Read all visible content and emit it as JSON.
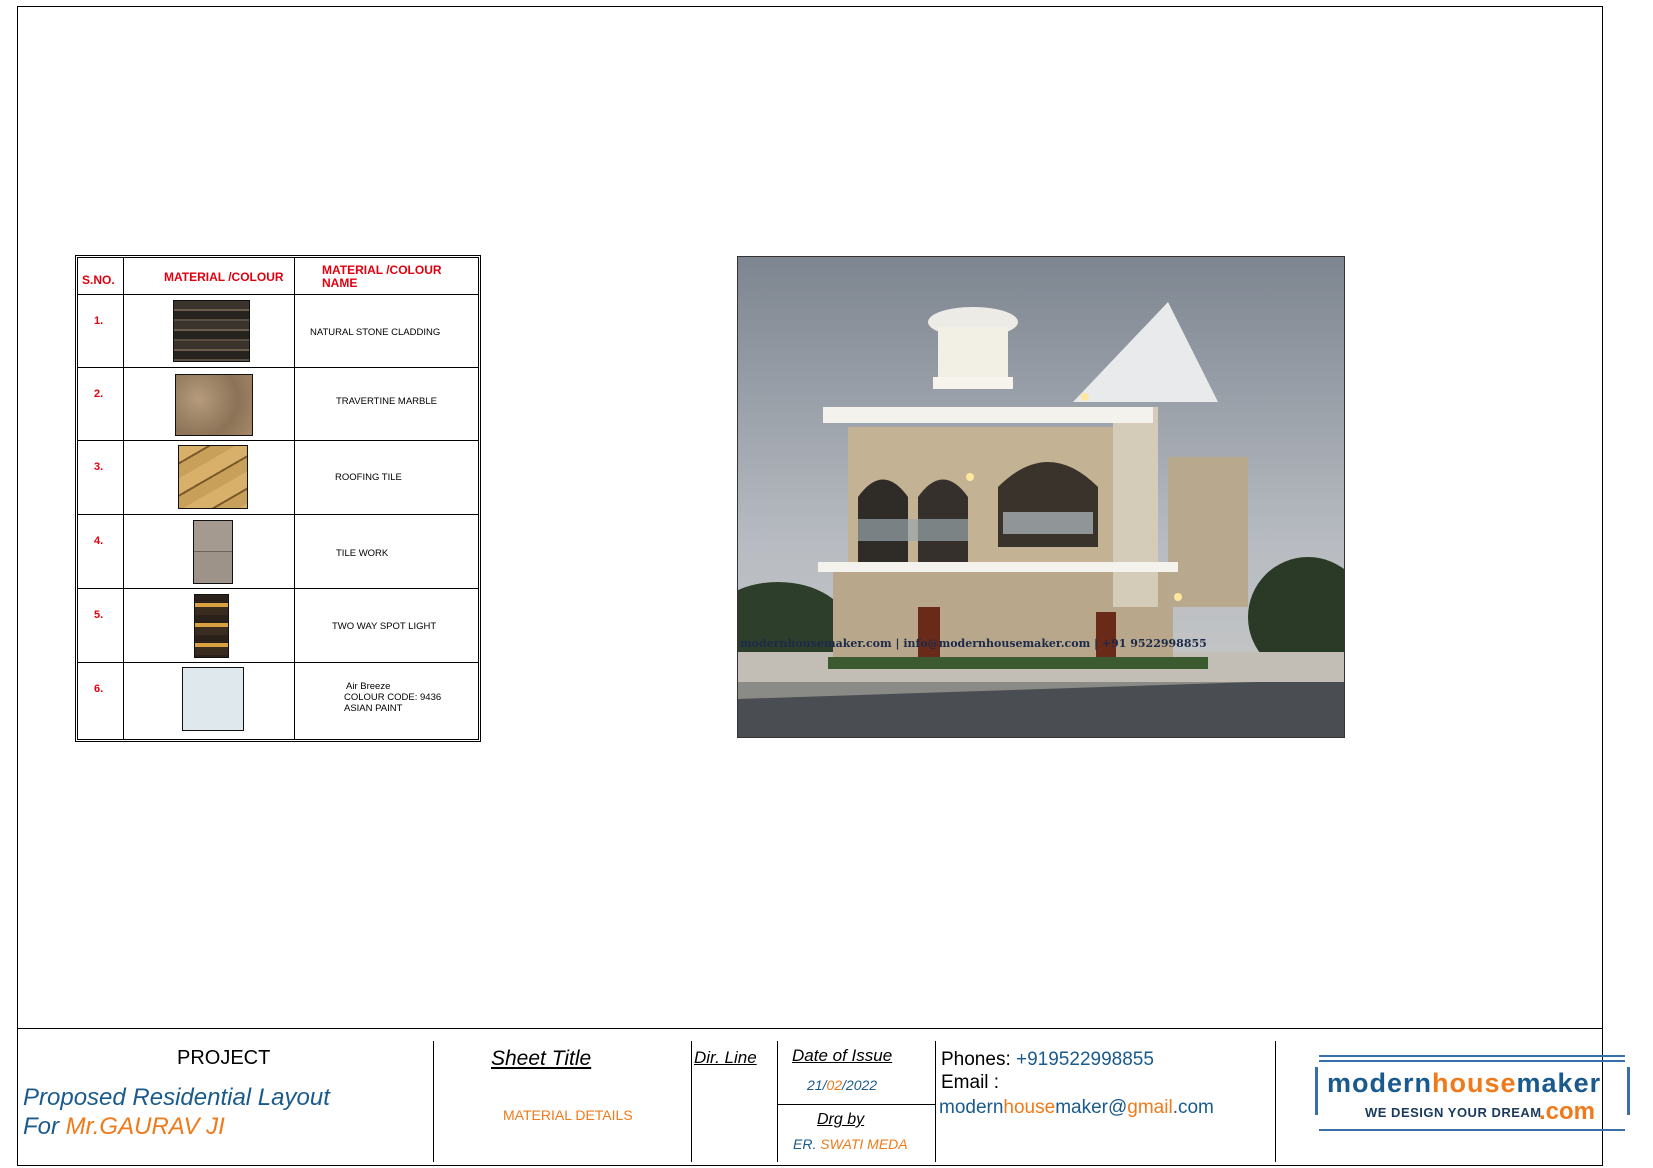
{
  "material_table": {
    "headers": {
      "sno": "S.NO.",
      "material": "MATERIAL /COLOUR",
      "name_line1": "MATERIAL /COLOUR",
      "name_line2": "NAME"
    },
    "rows": [
      {
        "sno": "1.",
        "name": "NATURAL STONE CLADDING"
      },
      {
        "sno": "2.",
        "name": "TRAVERTINE MARBLE"
      },
      {
        "sno": "3.",
        "name": "ROOFING TILE"
      },
      {
        "sno": "4.",
        "name": "TILE WORK"
      },
      {
        "sno": "5.",
        "name": "TWO WAY SPOT LIGHT"
      },
      {
        "sno": "6.",
        "name_lines": [
          "Air Breeze",
          "COLOUR CODE: 9436",
          "ASIAN PAINT"
        ]
      }
    ]
  },
  "render": {
    "watermark": "modernhousemaker.com | info@modernhousemaker.com | +91 9522998855"
  },
  "title_block": {
    "project_label": "PROJECT",
    "project_line1": "Proposed Residential Layout",
    "project_for": "For ",
    "client": "Mr.GAURAV JI",
    "sheet_title_label": "Sheet Title",
    "sheet_title": "MATERIAL DETAILS",
    "dir_line_label": "Dir. Line",
    "date_label": "Date of Issue",
    "date_day": "21/",
    "date_month": "02",
    "date_year": "/2022",
    "drg_label": "Drg by",
    "drg_prefix": "ER. ",
    "drg_name": "SWATI MEDA",
    "phones_label": "Phones:",
    "phone": "+919522998855",
    "email_label": "Email :",
    "email_a": "modern",
    "email_b": "house",
    "email_c": "maker@",
    "email_d": "gmail",
    "email_e": ".com"
  },
  "logo": {
    "part1": "modern",
    "part2": "house",
    "part3": "maker",
    "tagline": "WE DESIGN YOUR DREAM",
    "tld": ".com"
  },
  "colors": {
    "header_red": "#e00010",
    "brand_blue": "#1a5a8c",
    "brand_orange": "#f07a1a"
  }
}
